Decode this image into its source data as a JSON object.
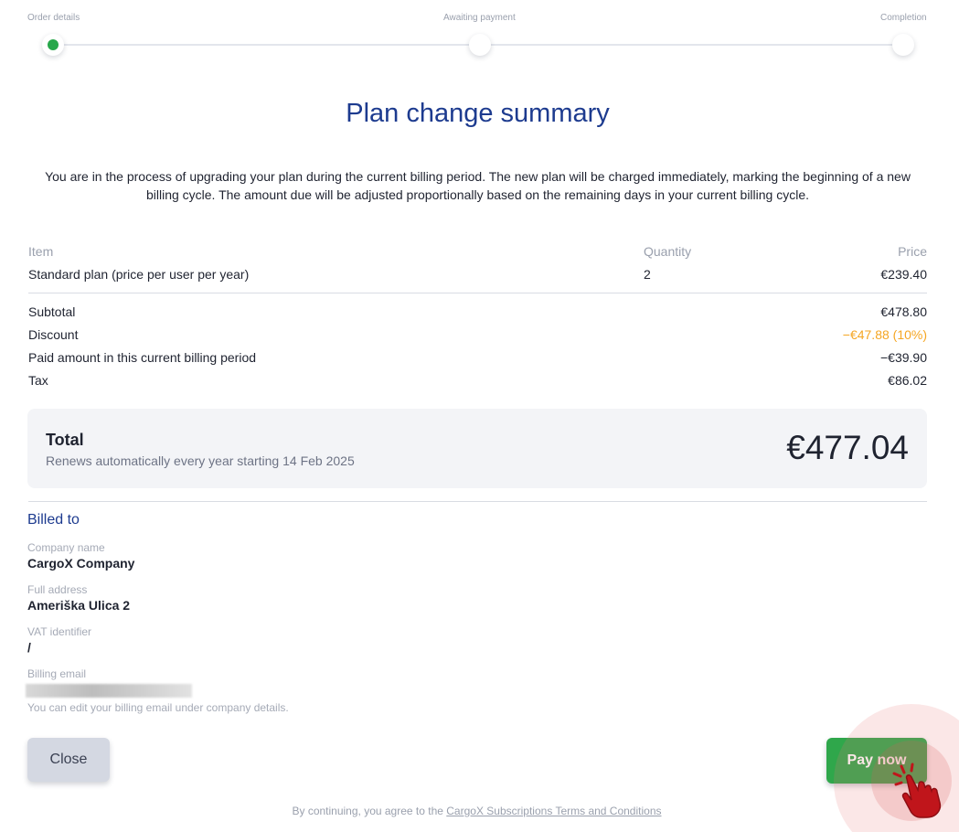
{
  "stepper": {
    "steps": [
      {
        "label": "Order details"
      },
      {
        "label": "Awaiting payment"
      },
      {
        "label": "Completion"
      }
    ],
    "active_color": "#27a74a"
  },
  "title": "Plan change summary",
  "intro": "You are in the process of upgrading your plan during the current billing period. The new plan will be charged immediately, marking the beginning of a new billing cycle. The amount due will be adjusted proportionally based on the remaining days in your current billing cycle.",
  "items": {
    "headers": {
      "item": "Item",
      "quantity": "Quantity",
      "price": "Price"
    },
    "rows": [
      {
        "item": "Standard plan (price per user per year)",
        "quantity": "2",
        "price": "€239.40"
      }
    ]
  },
  "summary": {
    "subtotal": {
      "label": "Subtotal",
      "value": "€478.80"
    },
    "discount": {
      "label": "Discount",
      "value": "−€47.88 (10%)"
    },
    "paid": {
      "label": "Paid amount in this current billing period",
      "value": "−€39.90"
    },
    "tax": {
      "label": "Tax",
      "value": "€86.02"
    }
  },
  "total": {
    "label": "Total",
    "subtitle": "Renews automatically every year starting 14 Feb 2025",
    "amount": "€477.04"
  },
  "billed_to": {
    "title": "Billed to",
    "company_label": "Company name",
    "company_value": "CargoX Company",
    "address_label": "Full address",
    "address_value": "Ameriška Ulica 2",
    "vat_label": "VAT identifier",
    "vat_value": "/",
    "email_label": "Billing email",
    "email_note": "You can edit your billing email under company details."
  },
  "buttons": {
    "close": "Close",
    "pay": "Pay now"
  },
  "footer": {
    "prefix": "By continuing, you agree to the ",
    "link": "CargoX Subscriptions Terms and Conditions"
  },
  "colors": {
    "title": "#1d3b8f",
    "discount": "#f5a623",
    "pay_button": "#2fa74b",
    "close_button": "#d4d8e2"
  },
  "icons": {
    "cursor": "hand-pointer-icon"
  }
}
